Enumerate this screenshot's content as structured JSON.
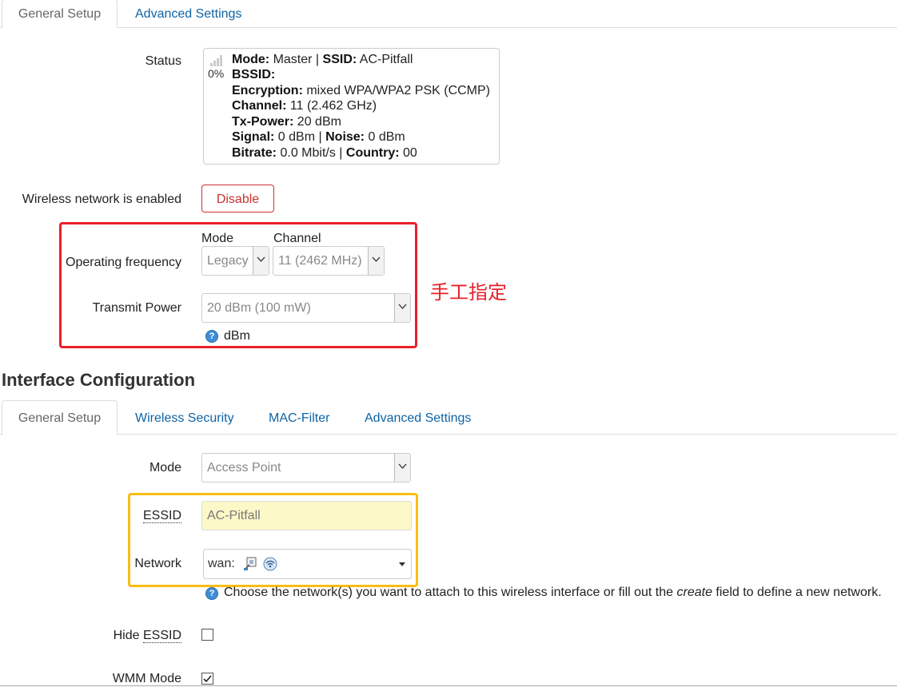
{
  "device_tabs": [
    {
      "label": "General Setup",
      "active": true
    },
    {
      "label": "Advanced Settings",
      "active": false
    }
  ],
  "status": {
    "label": "Status",
    "signal_percent": "0%",
    "mode_key": "Mode:",
    "mode_val": "Master",
    "sep": "|",
    "ssid_key": "SSID:",
    "ssid_val": "AC-Pitfall",
    "bssid_key": "BSSID:",
    "encryption_key": "Encryption:",
    "encryption_val": "mixed WPA/WPA2 PSK (CCMP)",
    "channel_key": "Channel:",
    "channel_val": "11 (2.462 GHz)",
    "txpower_key": "Tx-Power:",
    "txpower_val": "20 dBm",
    "signal_key": "Signal:",
    "signal_val": "0 dBm",
    "noise_key": "Noise:",
    "noise_val": "0 dBm",
    "bitrate_key": "Bitrate:",
    "bitrate_val": "0.0 Mbit/s",
    "country_key": "Country:",
    "country_val": "00"
  },
  "wireless_enabled": {
    "label": "Wireless network is enabled",
    "button": "Disable"
  },
  "operating_frequency": {
    "label": "Operating frequency",
    "mode_header": "Mode",
    "channel_header": "Channel",
    "mode_value": "Legacy",
    "channel_value": "11 (2462 MHz)"
  },
  "transmit_power": {
    "label": "Transmit Power",
    "value": "20 dBm (100 mW)",
    "help": "dBm"
  },
  "annotation": "手工指定",
  "interface_config": {
    "title": "Interface Configuration",
    "tabs": [
      {
        "label": "General Setup",
        "active": true
      },
      {
        "label": "Wireless Security",
        "active": false
      },
      {
        "label": "MAC-Filter",
        "active": false
      },
      {
        "label": "Advanced Settings",
        "active": false
      }
    ],
    "mode_label": "Mode",
    "mode_value": "Access Point",
    "essid_label": "ESSID",
    "essid_value": "AC-Pitfall",
    "network_label": "Network",
    "network_value": "wan:",
    "network_help_pre": "Choose the network(s) you want to attach to this wireless interface or fill out the ",
    "network_help_em": "create",
    "network_help_post": " field to define a new network.",
    "hide_essid_label_pre": "Hide ",
    "hide_essid_label_abbr": "ESSID",
    "hide_essid_checked": false,
    "wmm_label": "WMM Mode",
    "wmm_checked": true
  },
  "colors": {
    "link": "#0e64a6",
    "highlight_red": "#e8202a",
    "highlight_yellow": "#fbbd14",
    "essid_bg": "#fdf8c8"
  }
}
